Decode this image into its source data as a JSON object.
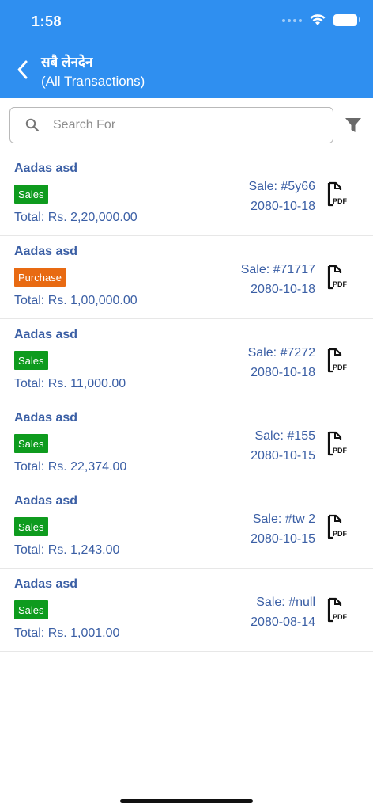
{
  "status_bar": {
    "time": "1:58"
  },
  "header": {
    "title_ne": "सबै लेनदेन",
    "title_en": "(All Transactions)",
    "back_icon": "chevron-left-icon"
  },
  "search": {
    "placeholder": "Search For",
    "value": "",
    "icon": "search-icon"
  },
  "filter_icon": "filter-icon",
  "colors": {
    "appbar": "#2f8ff0",
    "text_blue": "#3b5fa5",
    "badge_sales": "#0e9b1e",
    "badge_purchase": "#e86a12"
  },
  "transactions": [
    {
      "name": "Aadas asd",
      "type": "Sales",
      "total": "Total: Rs. 2,20,000.00",
      "ref": "Sale: #5y66",
      "date": "2080-10-18",
      "pdf_label": "PDF"
    },
    {
      "name": "Aadas asd",
      "type": "Purchase",
      "total": "Total: Rs. 1,00,000.00",
      "ref": "Sale: #71717",
      "date": "2080-10-18",
      "pdf_label": "PDF"
    },
    {
      "name": "Aadas asd",
      "type": "Sales",
      "total": "Total: Rs. 11,000.00",
      "ref": "Sale: #7272",
      "date": "2080-10-18",
      "pdf_label": "PDF"
    },
    {
      "name": "Aadas asd",
      "type": "Sales",
      "total": "Total: Rs. 22,374.00",
      "ref": "Sale: #155",
      "date": "2080-10-15",
      "pdf_label": "PDF"
    },
    {
      "name": "Aadas asd",
      "type": "Sales",
      "total": "Total: Rs. 1,243.00",
      "ref": "Sale: #tw 2",
      "date": "2080-10-15",
      "pdf_label": "PDF"
    },
    {
      "name": "Aadas asd",
      "type": "Sales",
      "total": "Total: Rs. 1,001.00",
      "ref": "Sale: #null",
      "date": "2080-08-14",
      "pdf_label": "PDF"
    }
  ]
}
